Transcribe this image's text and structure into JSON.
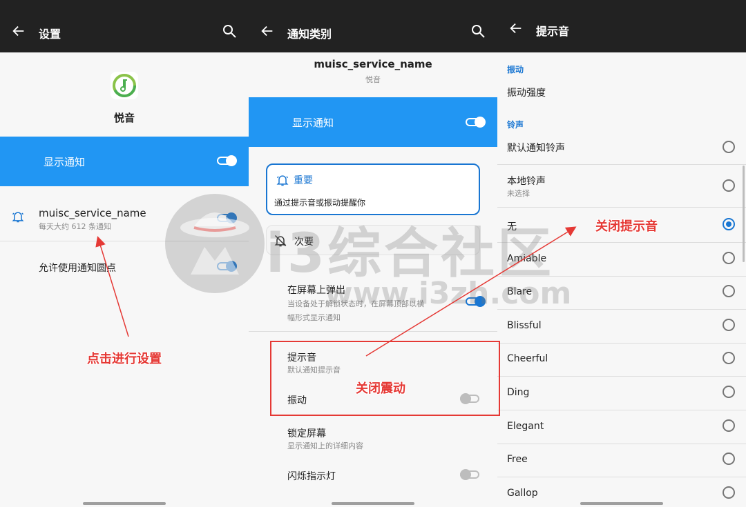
{
  "colors": {
    "accent": "#2196f3",
    "accent_dark": "#1976d2",
    "topbar": "#222222",
    "annotation_red": "#e53935"
  },
  "panel1": {
    "title": "设置",
    "app_name": "悦音",
    "show_notifications": "显示通知",
    "show_notifications_on": true,
    "channel": {
      "name": "muisc_service_name",
      "desc": "每天大约 612 条通知",
      "enabled": true
    },
    "allow_dot": "允许使用通知圆点",
    "allow_dot_on": true,
    "annotation": "点击进行设置"
  },
  "panel2": {
    "title": "通知类别",
    "channel_title": "muisc_service_name",
    "channel_app": "悦音",
    "show_notifications": "显示通知",
    "show_notifications_on": true,
    "important": {
      "label": "重要",
      "desc": "通过提示音或振动提醒你"
    },
    "quiet": {
      "label": "次要"
    },
    "popup": {
      "label": "在屏幕上弹出",
      "desc_line1": "当设备处于解锁状态时，在屏幕顶部以横",
      "desc_line2": "幅形式显示通知",
      "on": true
    },
    "sound": {
      "label": "提示音",
      "desc": "默认通知提示音"
    },
    "vibrate": {
      "label": "振动",
      "on": false
    },
    "lockscreen": {
      "label": "锁定屏幕",
      "desc": "显示通知上的详细内容"
    },
    "led": {
      "label": "闪烁指示灯",
      "on": false
    },
    "annotation": "关闭震动"
  },
  "panel3": {
    "title": "提示音",
    "vibration_section": "振动",
    "vibration_strength": "振动强度",
    "ringtone_section": "铃声",
    "default_ringtone": "默认通知铃声",
    "local_ringtone": "本地铃声",
    "local_ringtone_desc": "未选择",
    "tones": [
      "无",
      "Amiable",
      "Blare",
      "Blissful",
      "Cheerful",
      "Ding",
      "Elegant",
      "Free",
      "Gallop"
    ],
    "selected_tone": "无",
    "annotation": "关闭提示音"
  },
  "watermark": {
    "name": "i3综合社区",
    "url": "www.i3zh.com"
  }
}
